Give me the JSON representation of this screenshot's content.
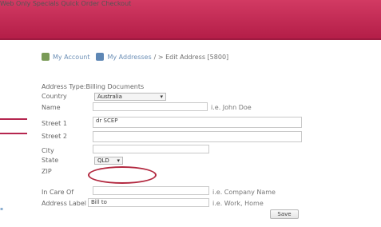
{
  "nav": {
    "item1": "Web Only Specials",
    "item2": "Quick Order",
    "item3": "Checkout"
  },
  "breadcrumb": {
    "account": "My Account",
    "addresses": "My Addresses",
    "current": "/ > Edit Address [5800]"
  },
  "form": {
    "address_type_label": "Address Type:",
    "address_type_value": "Billing Documents",
    "country_label": "Country",
    "country_value": "Australia",
    "name_label": "Name",
    "name_value": "",
    "name_hint": "i.e. John Doe",
    "street1_label": "Street 1",
    "street1_value": "dr SCEP",
    "street2_label": "Street 2",
    "street2_value": "",
    "city_label": "City",
    "city_value": "",
    "state_label": "State",
    "state_value": "QLD",
    "zip_label": "ZIP",
    "zip_value": "",
    "incareof_label": "In Care Of",
    "incareof_value": "",
    "incareof_hint": "i.e. Company Name",
    "addresslabel_label": "Address Label",
    "addresslabel_value": "Bill to",
    "addresslabel_hint": "i.e. Work, Home",
    "save_label": "Save"
  },
  "colors": {
    "topbar": "#c02a55",
    "highlight_ellipse": "#b2283f",
    "link": "#6c8fb6"
  },
  "icons": {
    "account": "account-icon",
    "addresses": "addresses-icon"
  }
}
